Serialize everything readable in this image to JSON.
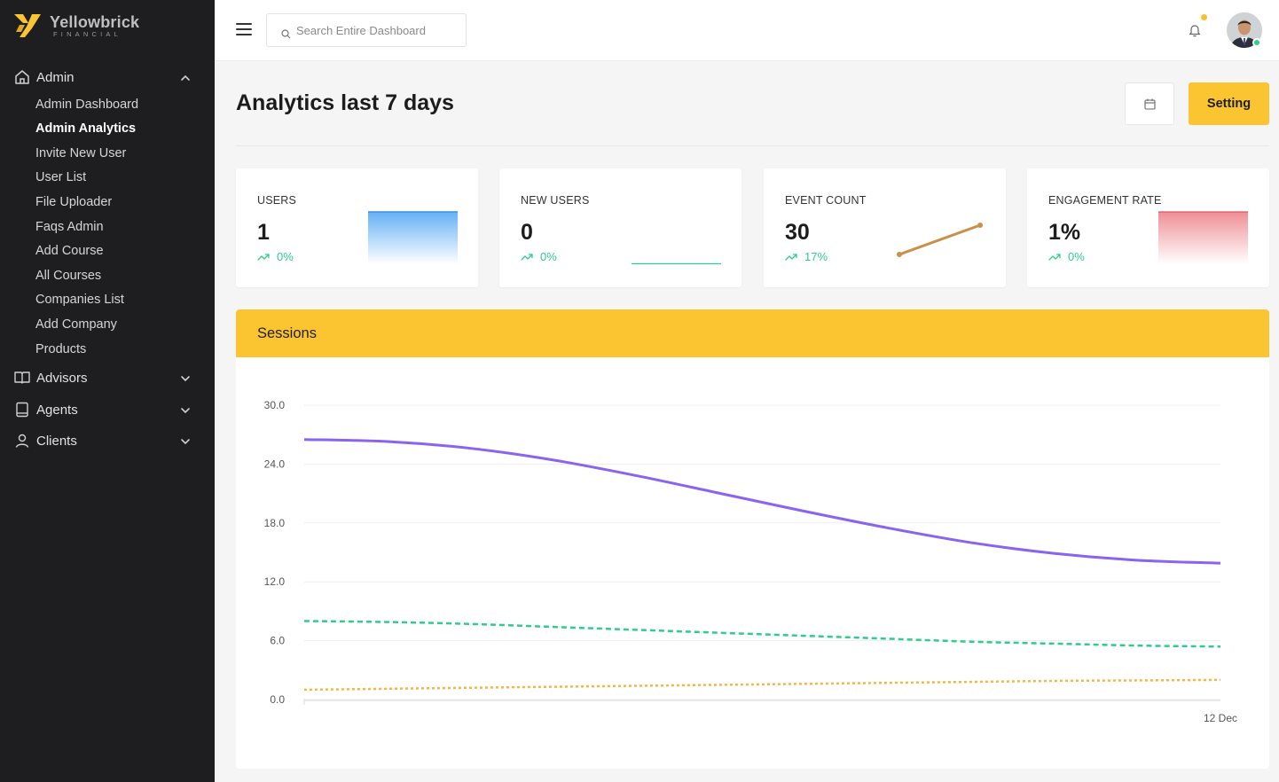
{
  "brand": {
    "name": "Yellowbrick",
    "sub": "FINANCIAL",
    "logo_icon": "yellowbrick-logo-icon",
    "accent": "#fbc531"
  },
  "sidebar": {
    "admin": {
      "label": "Admin",
      "icon": "home-icon",
      "expanded": true,
      "items": [
        {
          "label": "Admin Dashboard",
          "active": false
        },
        {
          "label": "Admin Analytics",
          "active": true
        },
        {
          "label": "Invite New User",
          "active": false
        },
        {
          "label": "User List",
          "active": false
        },
        {
          "label": "File Uploader",
          "active": false
        },
        {
          "label": "Faqs Admin",
          "active": false
        },
        {
          "label": "Add Course",
          "active": false
        },
        {
          "label": "All Courses",
          "active": false
        },
        {
          "label": "Companies List",
          "active": false
        },
        {
          "label": "Add Company",
          "active": false
        },
        {
          "label": "Products",
          "active": false
        }
      ]
    },
    "advisors": {
      "label": "Advisors",
      "icon": "book-icon"
    },
    "agents": {
      "label": "Agents",
      "icon": "tablet-icon"
    },
    "clients": {
      "label": "Clients",
      "icon": "user-icon"
    }
  },
  "topbar": {
    "search_placeholder": "Search Entire Dashboard",
    "notification_icon": "bell-icon",
    "notification_dot_color": "#f5c12e",
    "avatar_status_color": "#2ecc8f"
  },
  "header": {
    "title": "Analytics last 7 days",
    "calendar_icon": "calendar-icon",
    "setting_label": "Setting"
  },
  "stats": [
    {
      "label": "USERS",
      "value": "1",
      "trend": "0%",
      "spark_color": "#54a8f5"
    },
    {
      "label": "NEW USERS",
      "value": "0",
      "trend": "0%",
      "spark_color": "#2ecc8f"
    },
    {
      "label": "EVENT COUNT",
      "value": "30",
      "trend": "17%",
      "spark_color": "#c8914a"
    },
    {
      "label": "ENGAGEMENT RATE",
      "value": "1%",
      "trend": "0%",
      "spark_color": "#e86a72"
    }
  ],
  "sessions": {
    "title": "Sessions"
  },
  "chart_data": {
    "type": "line",
    "x": [
      "",
      "12 Dec"
    ],
    "xlabel": "",
    "ylabel": "",
    "ylim": [
      0,
      30
    ],
    "yticks": [
      "30.0",
      "24.0",
      "18.0",
      "12.0",
      "6.0",
      "0.0"
    ],
    "grid": true,
    "series": [
      {
        "style": "solid",
        "color": "#8a63f0",
        "values": [
          26.5,
          26.3,
          25.6,
          24.4,
          22.8,
          21.0,
          19.2,
          17.5,
          16.0,
          14.9,
          14.2,
          13.9
        ]
      },
      {
        "style": "dashed",
        "color": "#2ecc8f",
        "values": [
          8.0,
          7.9,
          7.7,
          7.4,
          7.1,
          6.8,
          6.5,
          6.2,
          5.9,
          5.7,
          5.5,
          5.4
        ]
      },
      {
        "style": "dotted",
        "color": "#f5b642",
        "values": [
          1.0,
          1.1,
          1.2,
          1.3,
          1.4,
          1.5,
          1.6,
          1.7,
          1.8,
          1.9,
          1.95,
          2.0
        ]
      }
    ]
  }
}
